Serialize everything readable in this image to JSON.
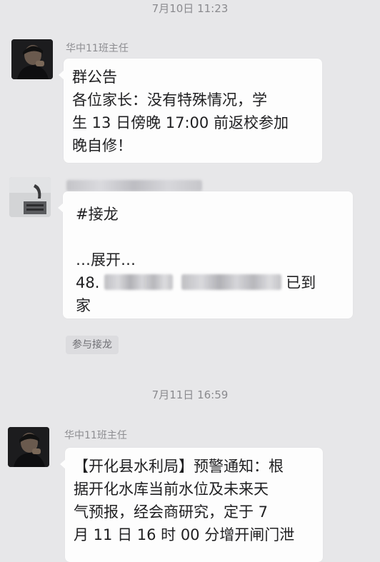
{
  "messages": [
    {
      "timestamp": "7月10日 11:23",
      "sender": "华中11班主任",
      "lines": [
        "群公告",
        "各位家长：没有特殊情况，学",
        "生 13 日傍晚 17:00 前返校参加",
        "晚自修！"
      ]
    },
    {
      "sender_hidden": true,
      "title": "#接龙",
      "expand": "…展开…",
      "entry_prefix": "48. ",
      "entry_suffix": "已到",
      "entry_last": "家",
      "action": "参与接龙"
    },
    {
      "timestamp": "7月11日 16:59",
      "sender": "华中11班主任",
      "lines": [
        "【开化县水利局】预警通知：根",
        "据开化水库当前水位及未来天",
        "气预报，经会商研究，定于 7",
        "月 11 日 16 时 00 分增开闸门泄"
      ]
    }
  ]
}
